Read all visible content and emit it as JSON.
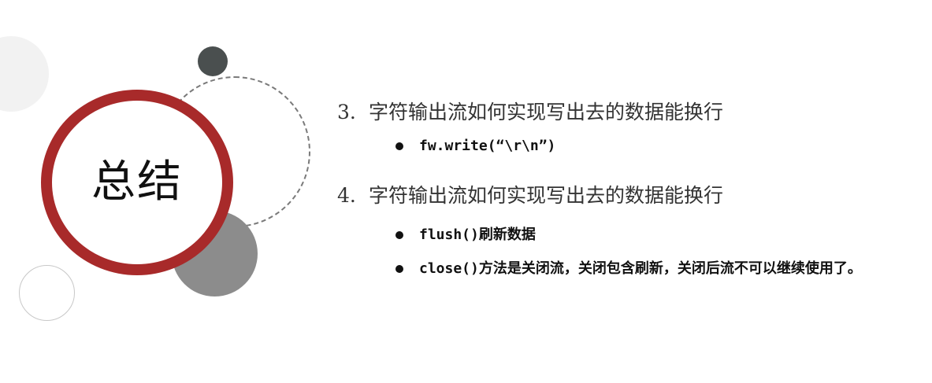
{
  "title": "总结",
  "sections": [
    {
      "number": "3.",
      "heading": "字符输出流如何实现写出去的数据能换行",
      "bullets": [
        "fw.write(“\\r\\n”)"
      ]
    },
    {
      "number": "4.",
      "heading": "字符输出流如何实现写出去的数据能换行",
      "bullets": [
        "flush()刷新数据",
        "close()方法是关闭流，关闭包含刷新，关闭后流不可以继续使用了。"
      ]
    }
  ],
  "colors": {
    "ring": "#a82a2a",
    "dark_circle": "#4a4f4f",
    "gray_circle": "#8c8c8c",
    "light_circle": "#f2f2f2"
  }
}
